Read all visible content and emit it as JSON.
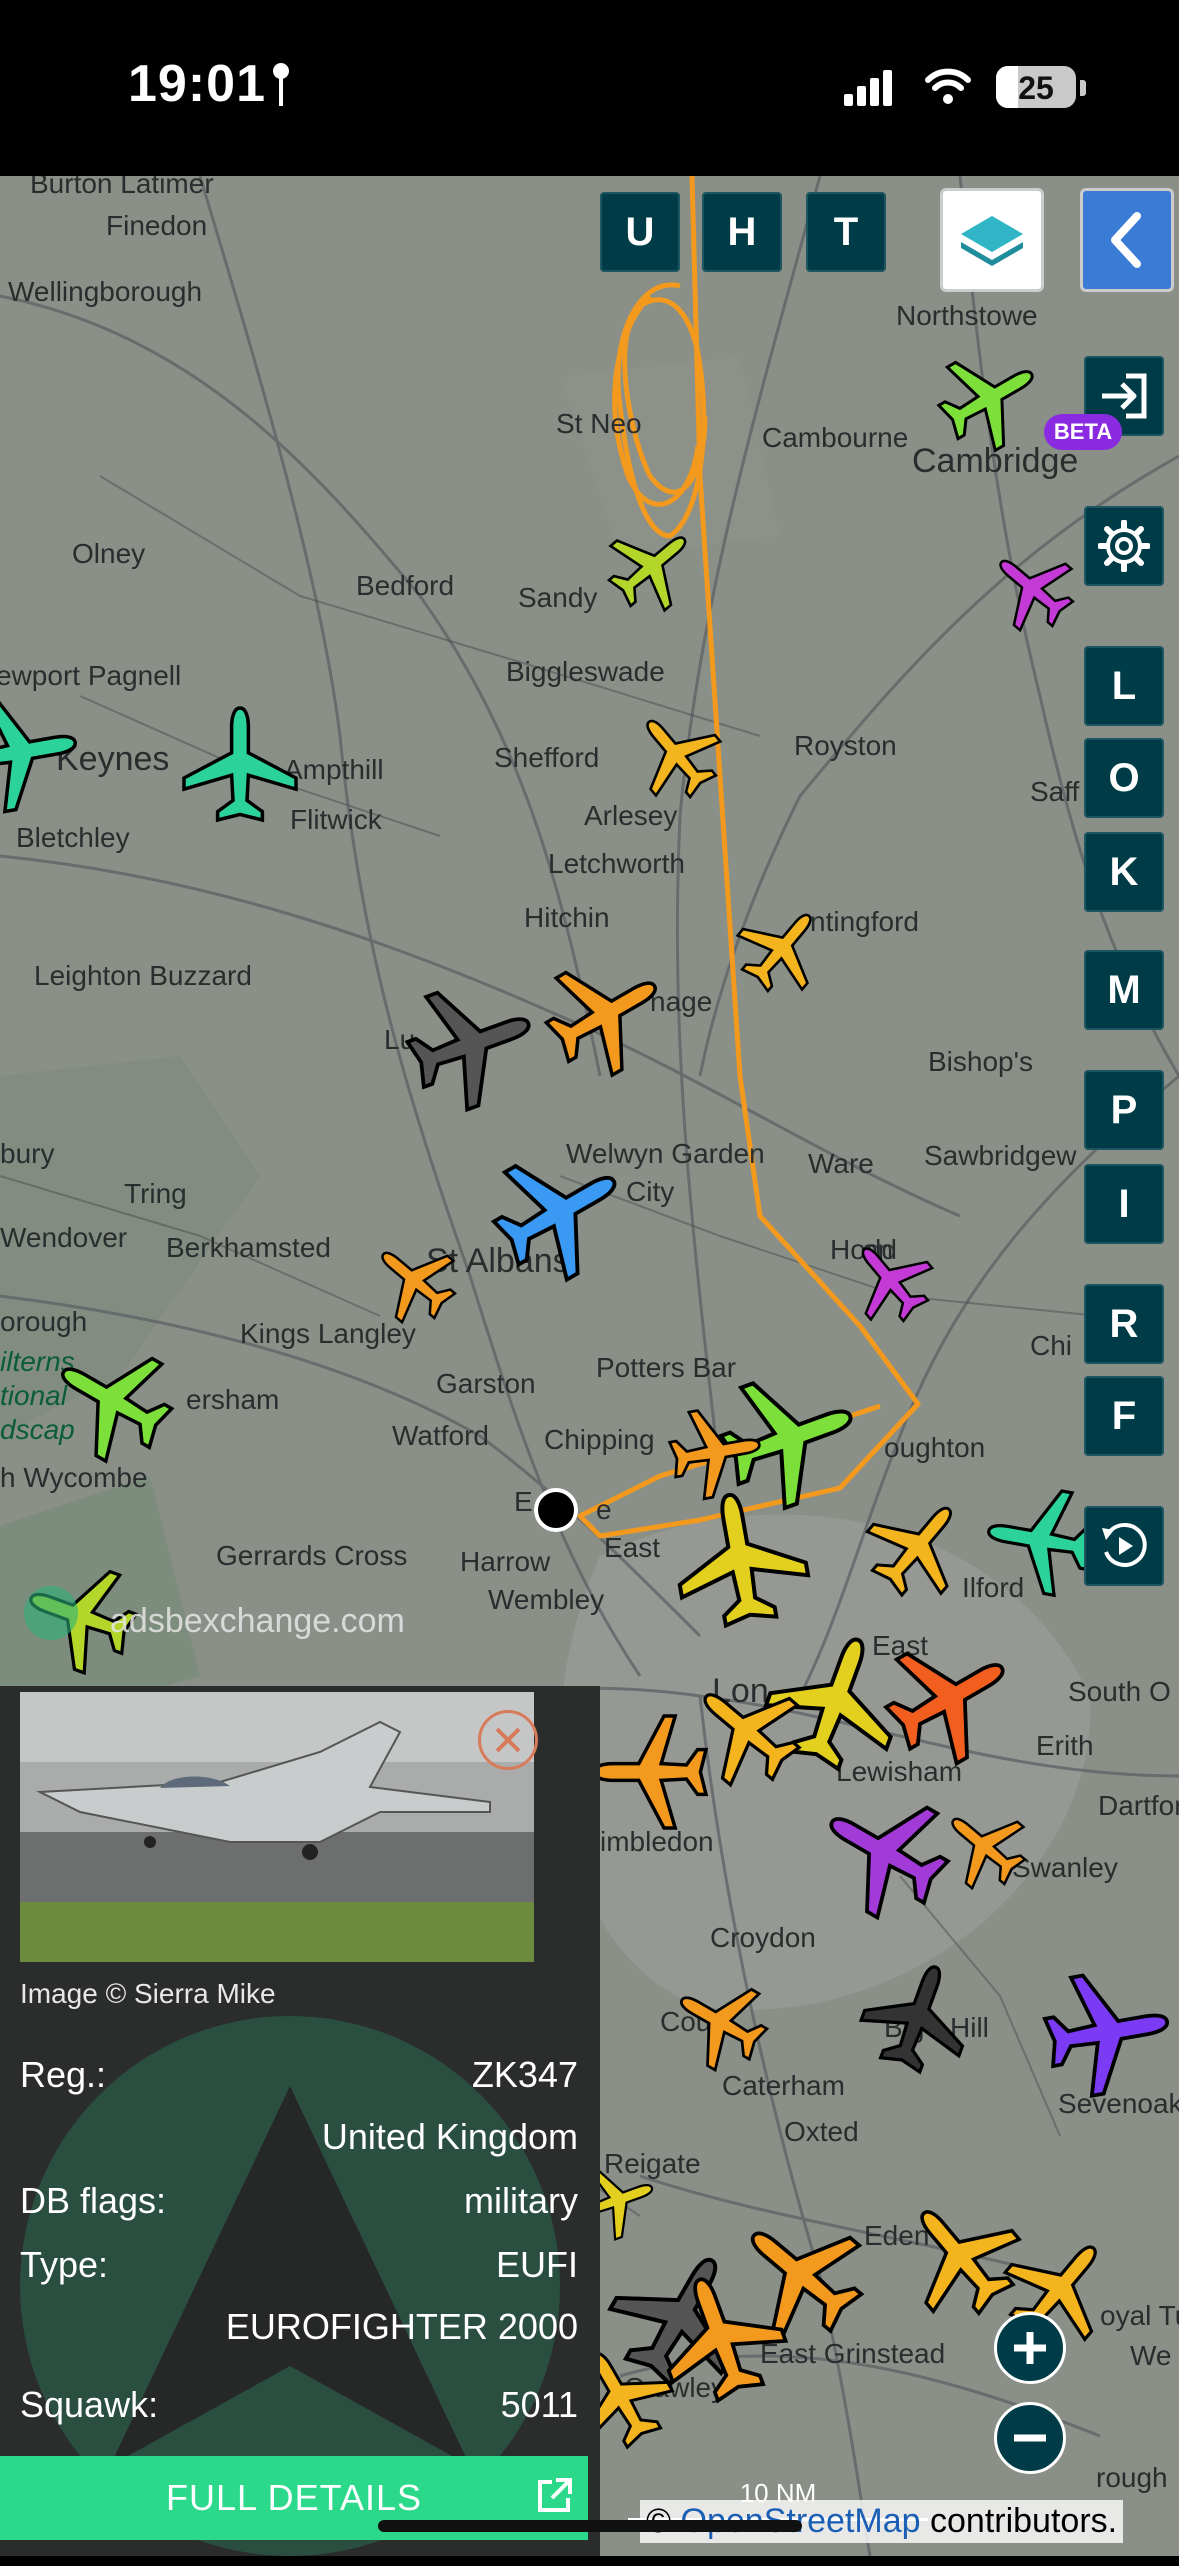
{
  "status": {
    "time": "19:01",
    "battery": "25"
  },
  "map_buttons": {
    "u": "U",
    "h": "H",
    "t": "T"
  },
  "side_buttons": [
    "L",
    "O",
    "K",
    "M",
    "P",
    "I",
    "R",
    "F"
  ],
  "beta_label": "BETA",
  "places": [
    {
      "id": "burton-latimer",
      "label": "Burton Latimer"
    },
    {
      "id": "finedon",
      "label": "Finedon"
    },
    {
      "id": "wellingborough",
      "label": "Wellingborough"
    },
    {
      "id": "northstowe",
      "label": "Northstowe"
    },
    {
      "id": "st-neots",
      "label": "St Neo"
    },
    {
      "id": "cambourne",
      "label": "Cambourne"
    },
    {
      "id": "cambridge",
      "label": "Cambridge"
    },
    {
      "id": "olney",
      "label": "Olney"
    },
    {
      "id": "bedford",
      "label": "Bedford"
    },
    {
      "id": "sandy",
      "label": "Sandy"
    },
    {
      "id": "newport-pagnell",
      "label": "ewport Pagnell"
    },
    {
      "id": "biggleswade",
      "label": "Biggleswade"
    },
    {
      "id": "keynes",
      "label": "Keynes"
    },
    {
      "id": "ampthill",
      "label": "Ampthill"
    },
    {
      "id": "shefford",
      "label": "Shefford"
    },
    {
      "id": "royston",
      "label": "Royston"
    },
    {
      "id": "flitwick",
      "label": "Flitwick"
    },
    {
      "id": "bletchley",
      "label": "Bletchley"
    },
    {
      "id": "arlesey",
      "label": "Arlesey"
    },
    {
      "id": "saffron",
      "label": "Saff"
    },
    {
      "id": "letchworth",
      "label": "Letchworth"
    },
    {
      "id": "hitchin",
      "label": "Hitchin"
    },
    {
      "id": "buntingford",
      "label": "ntingford"
    },
    {
      "id": "leighton-buzzard",
      "label": "Leighton Buzzard"
    },
    {
      "id": "stevenage",
      "label": "nage"
    },
    {
      "id": "luton",
      "label": "Lu"
    },
    {
      "id": "bishops",
      "label": "Bishop's"
    },
    {
      "id": "bury",
      "label": "bury"
    },
    {
      "id": "welwyn",
      "label": "Welwyn Garden"
    },
    {
      "id": "welwyn-city",
      "label": "City"
    },
    {
      "id": "ware",
      "label": "Ware"
    },
    {
      "id": "sawbridgeworth",
      "label": "Sawbridgew"
    },
    {
      "id": "tring",
      "label": "Tring"
    },
    {
      "id": "wendover",
      "label": "Wendover"
    },
    {
      "id": "berkhamsted",
      "label": "Berkhamsted"
    },
    {
      "id": "st-albans",
      "label": "St Albans"
    },
    {
      "id": "hoddesdon",
      "label": "Hodd"
    },
    {
      "id": "hoddesdon-2",
      "label": "on"
    },
    {
      "id": "borough",
      "label": "orough"
    },
    {
      "id": "kings-langley",
      "label": "Kings Langley"
    },
    {
      "id": "chilterns",
      "label": "ilterns"
    },
    {
      "id": "potters-bar",
      "label": "Potters Bar"
    },
    {
      "id": "chi",
      "label": "Chi"
    },
    {
      "id": "national",
      "label": "tional"
    },
    {
      "id": "amersham",
      "label": "ersham"
    },
    {
      "id": "garston",
      "label": "Garston"
    },
    {
      "id": "landscape",
      "label": "dscap"
    },
    {
      "id": "watford",
      "label": "Watford"
    },
    {
      "id": "chipping",
      "label": "Chipping"
    },
    {
      "id": "loughton",
      "label": "oughton"
    },
    {
      "id": "high-wycombe",
      "label": "h Wycombe"
    },
    {
      "id": "gerrards-cross",
      "label": "Gerrards Cross"
    },
    {
      "id": "harrow",
      "label": "Harrow"
    },
    {
      "id": "east",
      "label": "East"
    },
    {
      "id": "ilford",
      "label": "Ilford"
    },
    {
      "id": "wembley",
      "label": "Wembley"
    },
    {
      "id": "east-ham",
      "label": "East"
    },
    {
      "id": "south-o",
      "label": "South O"
    },
    {
      "id": "london",
      "label": "Lon"
    },
    {
      "id": "erith",
      "label": "Erith"
    },
    {
      "id": "lewisham",
      "label": "Lewisham"
    },
    {
      "id": "wimbledon",
      "label": "imbledon"
    },
    {
      "id": "dartford",
      "label": "Dartford"
    },
    {
      "id": "swanley",
      "label": "Swanley"
    },
    {
      "id": "croydon",
      "label": "Croydon"
    },
    {
      "id": "coulsdon",
      "label": "Cou"
    },
    {
      "id": "biggin-hill",
      "label": "Big"
    },
    {
      "id": "biggin-hill-2",
      "label": "Hill"
    },
    {
      "id": "sevenoaks",
      "label": "Sevenoaks"
    },
    {
      "id": "caterham",
      "label": "Caterham"
    },
    {
      "id": "oxted",
      "label": "Oxted"
    },
    {
      "id": "reigate",
      "label": "Reigate"
    },
    {
      "id": "edenbridge",
      "label": "Eden"
    },
    {
      "id": "royal-tun",
      "label": "oyal Tu"
    },
    {
      "id": "we",
      "label": "We"
    },
    {
      "id": "east-grinstead",
      "label": "East Grinstead"
    },
    {
      "id": "crawley",
      "label": "Crawley"
    },
    {
      "id": "rough",
      "label": "rough"
    },
    {
      "id": "e-marker",
      "label": "E"
    },
    {
      "id": "e-marker-2",
      "label": "e"
    }
  ],
  "watermark": "adsbexchange.com",
  "aircraft_panel": {
    "image_credit": "Image © Sierra Mike",
    "reg_label": "Reg.:",
    "reg_value": "ZK347",
    "country": "United Kingdom",
    "db_flags_label": "DB flags:",
    "db_flags_value": "military",
    "type_label": "Type:",
    "type_value": "EUFI",
    "type_name": "EUROFIGHTER 2000",
    "squawk_label": "Squawk:",
    "squawk_value": "5011",
    "full_details": "FULL DETAILS"
  },
  "scale_label": "10 NM",
  "attribution": {
    "prefix": "©",
    "link": "OpenStreetMap",
    "suffix": "contributors."
  },
  "colors": {
    "panel_bg": "#2a2d2b",
    "button_bg": "#003c47",
    "full_details_bg": "#2cd98a",
    "track": "#f39a1e",
    "beta": "#8a2be2"
  },
  "icons": [
    "location-pin-icon",
    "signal-icon",
    "wifi-icon",
    "battery-icon",
    "layers-icon",
    "chevron-left-icon",
    "login-icon",
    "gear-icon",
    "replay-icon",
    "close-icon",
    "external-link-icon",
    "zoom-in-icon",
    "zoom-out-icon",
    "aircraft-icon"
  ]
}
